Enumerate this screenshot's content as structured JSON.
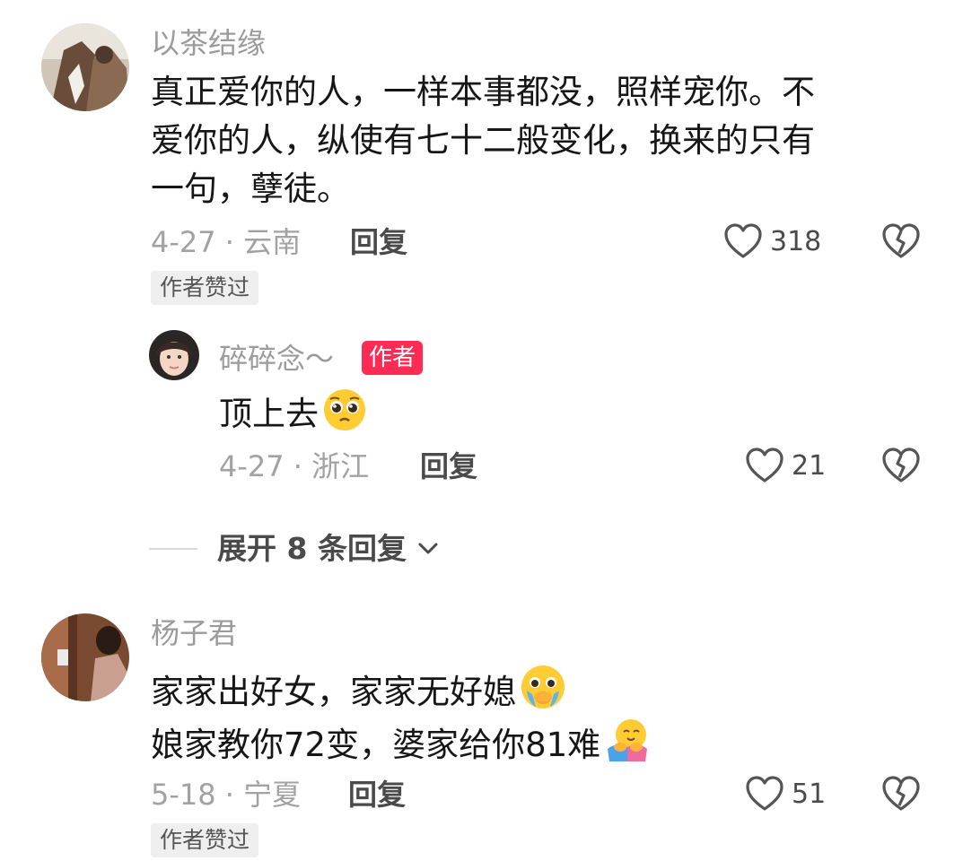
{
  "comments": [
    {
      "username": "以茶结缘",
      "text_lines": [
        "真正爱你的人，一样本事都没，照样宠你。不",
        "爱你的人，纵使有七十二般变化，换来的只有",
        "一句，孽徒。"
      ],
      "meta": "4-27 · 云南",
      "reply_label": "回复",
      "like_count": "318",
      "author_liked_badge": "作者赞过",
      "reply": {
        "username": "碎碎念～",
        "author_badge": "作者",
        "text": "顶上去",
        "emoji": "pleading-face",
        "meta": "4-27 · 浙江",
        "reply_label": "回复",
        "like_count": "21"
      },
      "expand_label": "展开 8 条回复"
    },
    {
      "username": "杨子君",
      "text_lines": [
        "家家出好女，家家无好媳",
        "娘家教你72变，婆家给你81难"
      ],
      "line_emojis": [
        "crying-face",
        "hugging-face"
      ],
      "meta": "5-18 · 宁夏",
      "reply_label": "回复",
      "like_count": "51",
      "author_liked_badge": "作者赞过"
    }
  ],
  "icons": {
    "like": "heart-outline-icon",
    "dislike": "broken-heart-icon",
    "expand": "chevron-down-icon"
  },
  "colors": {
    "author_badge": "#fe2c55",
    "username": "#9b9b9b",
    "text": "#161616"
  }
}
